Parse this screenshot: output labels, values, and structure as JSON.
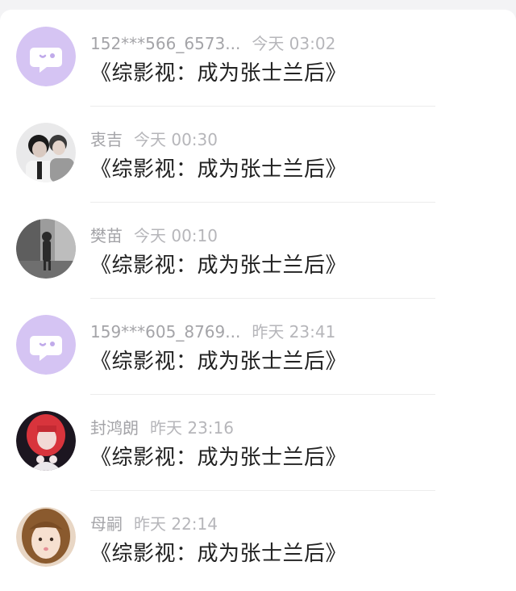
{
  "comments": [
    {
      "username": "152***566_6573...",
      "time": "今天 03:02",
      "message": "《综影视：成为张士兰后》",
      "avatar": "default-chat-avatar-icon"
    },
    {
      "username": "衷吉",
      "time": "今天 00:30",
      "message": "《综影视：成为张士兰后》",
      "avatar": "two-boys-photo"
    },
    {
      "username": "樊苗",
      "time": "今天 00:10",
      "message": "《综影视：成为张士兰后》",
      "avatar": "bw-street-photo"
    },
    {
      "username": "159***605_8769...",
      "time": "昨天 23:41",
      "message": "《综影视：成为张士兰后》",
      "avatar": "default-chat-avatar-icon"
    },
    {
      "username": "封鸿朗",
      "time": "昨天 23:16",
      "message": "《综影视：成为张士兰后》",
      "avatar": "red-hair-girl-photo"
    },
    {
      "username": "母嗣",
      "time": "昨天 22:14",
      "message": "《综影视：成为张士兰后》",
      "avatar": "girl-selfie-photo"
    }
  ],
  "colors": {
    "default_avatar_bg": "#d5c4f3",
    "default_avatar_fg": "#ffffff",
    "meta_text": "#a4a4a8",
    "message_text": "#222222"
  }
}
